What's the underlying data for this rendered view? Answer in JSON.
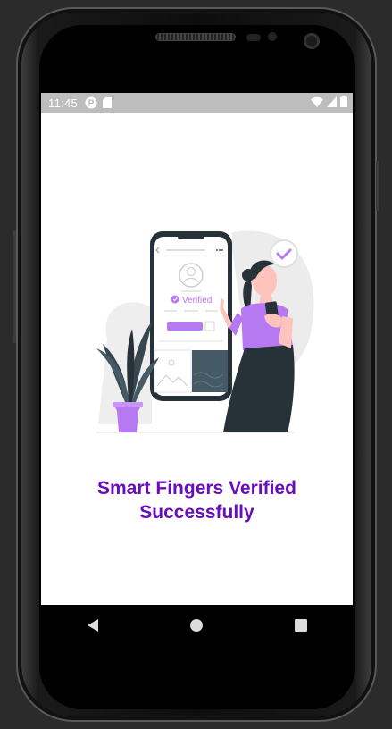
{
  "status_bar": {
    "time": "11:45",
    "left_icons": [
      "app-notification-icon",
      "sd-card-icon"
    ],
    "right_icons": [
      "wifi-icon",
      "cellular-signal-icon",
      "battery-icon"
    ]
  },
  "illustration": {
    "verified_label": "Verified"
  },
  "message": {
    "line1": "Smart Fingers Verified",
    "line2": "Successfully"
  },
  "nav_bar": {
    "buttons": [
      "back-icon",
      "home-icon",
      "recents-icon"
    ]
  },
  "colors": {
    "accent": "#6a0dbd",
    "illustration_purple": "#b779f2",
    "status_bar": "#bdbdbd",
    "dark": "#263238"
  }
}
